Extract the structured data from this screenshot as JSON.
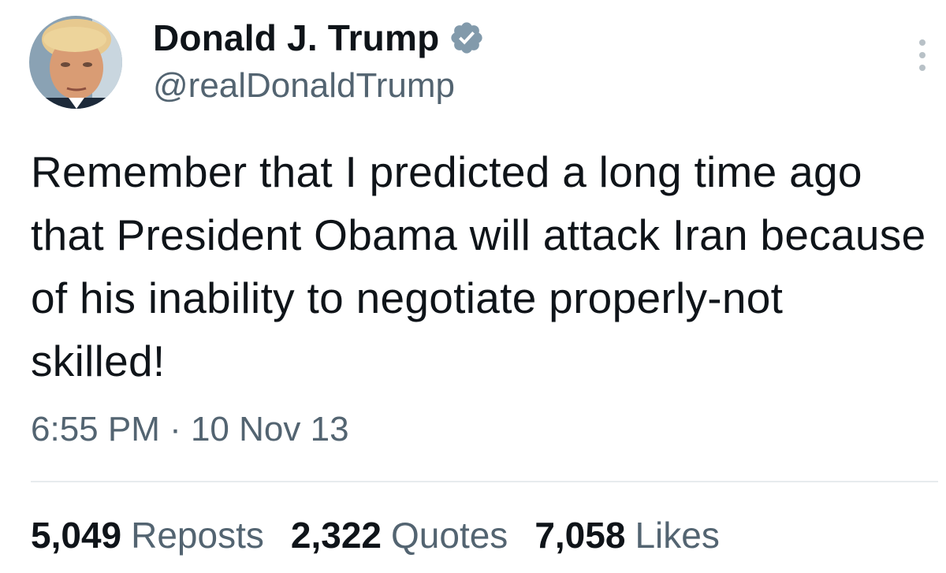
{
  "author": {
    "display_name": "Donald J. Trump",
    "handle": "@realDonaldTrump",
    "verified": true,
    "avatar": "profile-photo",
    "verified_color": "#829aab"
  },
  "tweet": {
    "text": "Remember that I predicted a long time ago that President Obama will attack Iran because of his inability to negotiate properly-not skilled!",
    "timestamp": "6:55 PM · 10 Nov 13"
  },
  "stats": {
    "reposts": {
      "count": "5,049",
      "label": "Reposts"
    },
    "quotes": {
      "count": "2,322",
      "label": "Quotes"
    },
    "likes": {
      "count": "7,058",
      "label": "Likes"
    }
  },
  "colors": {
    "text_primary": "#0f1419",
    "text_secondary": "#536471",
    "divider": "#e7ebee"
  },
  "icons": [
    "verified-badge-icon",
    "more-options-icon"
  ]
}
